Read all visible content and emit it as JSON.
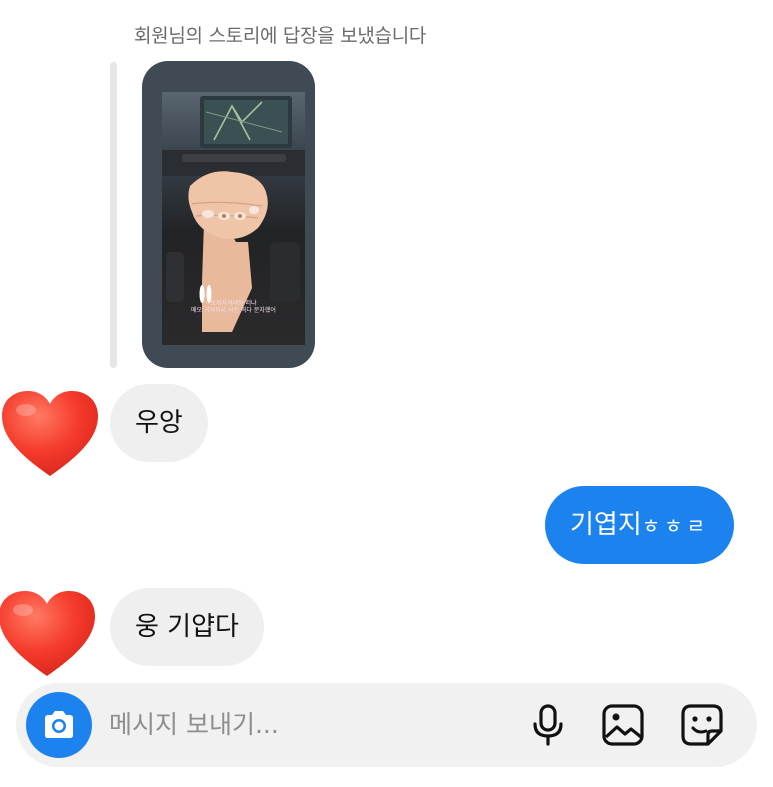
{
  "story": {
    "caption": "회원님의 스토리에 답장을 보냈습니다",
    "overlay_line1": "토끼자석대장 떠냐",
    "overlay_line2": "메모 귀여워서 사진 찍다 문자했어"
  },
  "messages": [
    {
      "from": "them",
      "avatar": "red-heart-icon",
      "text": "우앙"
    },
    {
      "from": "me",
      "text_main": "기엽지",
      "text_small": "ㅎㅎㄹ"
    },
    {
      "from": "them",
      "avatar": "red-heart-icon",
      "text": "웅 기얍다"
    }
  ],
  "composer": {
    "placeholder": "메시지 보내기...",
    "camera_icon": "camera-icon",
    "mic_icon": "microphone-icon",
    "gallery_icon": "image-icon",
    "sticker_icon": "sticker-icon"
  },
  "colors": {
    "accent": "#1c83ee",
    "incoming_bubble": "#efefef",
    "composer_bg": "#f1f1f1",
    "caption_text": "#6b6b6b",
    "placeholder_text": "#8e8e8e"
  }
}
